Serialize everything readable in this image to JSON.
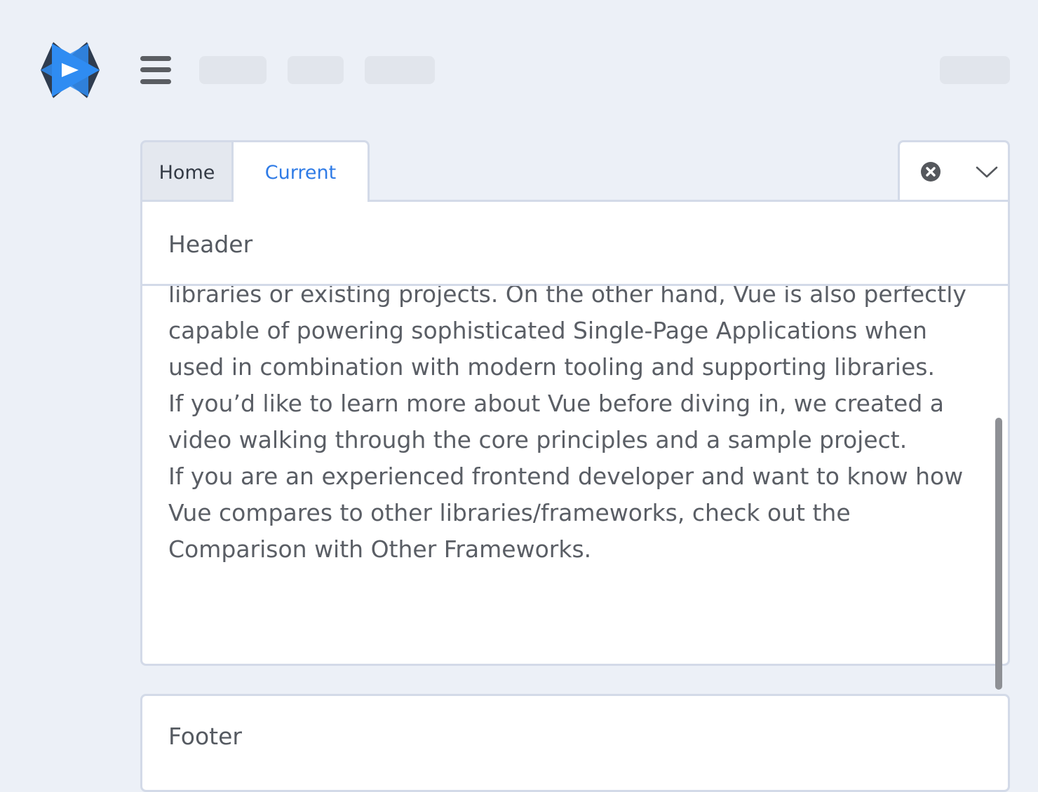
{
  "tabs": [
    {
      "label": "Home",
      "active": false
    },
    {
      "label": "Current",
      "active": true
    }
  ],
  "panel": {
    "header": "Header",
    "paragraphs": [
      "libraries or existing projects. On the other hand, Vue is also perfectly capable of powering sophisticated Single-Page Applications when used in combination with modern tooling and supporting libraries.",
      "If you’d like to learn more about Vue before diving in, we created a video walking through the core principles and a sample project.",
      "If you are an experienced frontend developer and want to know how Vue compares to other libraries/frameworks, check out the Comparison with Other Frameworks."
    ]
  },
  "footer": {
    "label": "Footer"
  },
  "icons": {
    "logo": "app-logo-icon",
    "menu": "hamburger-menu-icon",
    "close": "close-circle-icon",
    "dropdown": "chevron-down-icon"
  },
  "colors": {
    "accent": "#2f7be6",
    "background": "#ecf0f7",
    "border": "#d3dae8",
    "text": "#5a5e65"
  }
}
